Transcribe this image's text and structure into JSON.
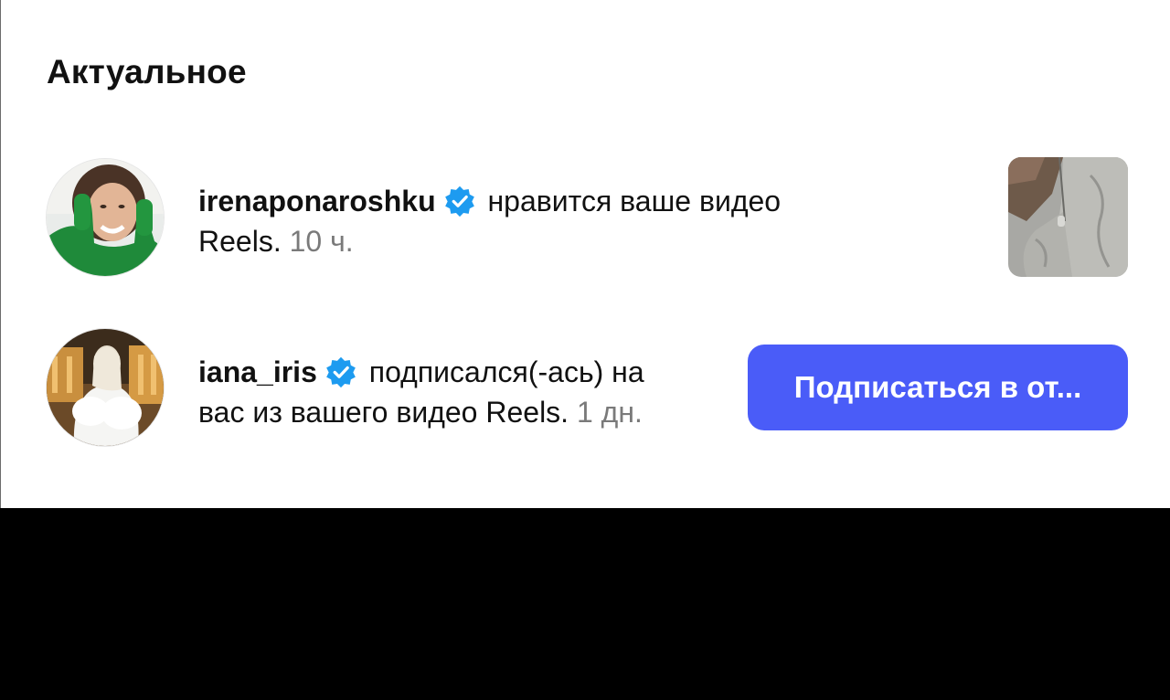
{
  "section": {
    "title": "Актуальное"
  },
  "notifications": [
    {
      "username": "irenaponaroshku",
      "verified": true,
      "text_line1": "нравится ваше видео",
      "text_line2": "Reels.",
      "time": "10 ч.",
      "avatar_icon": "avatar-woman-green-sweater",
      "thumbnail_icon": "reel-thumbnail-grey-hoodie"
    },
    {
      "username": "iana_iris",
      "verified": true,
      "text_line1": "подписался(-ась) на",
      "text_line2": "вас из вашего видео Reels.",
      "time": "1 дн.",
      "avatar_icon": "avatar-woman-white-fur",
      "button_label": "Подписаться в от..."
    }
  ],
  "colors": {
    "button_bg": "#4a5cf8",
    "verified_badge": "#1d9bf0",
    "timestamp": "#7a7a7a",
    "bottom_area": "#000000"
  }
}
